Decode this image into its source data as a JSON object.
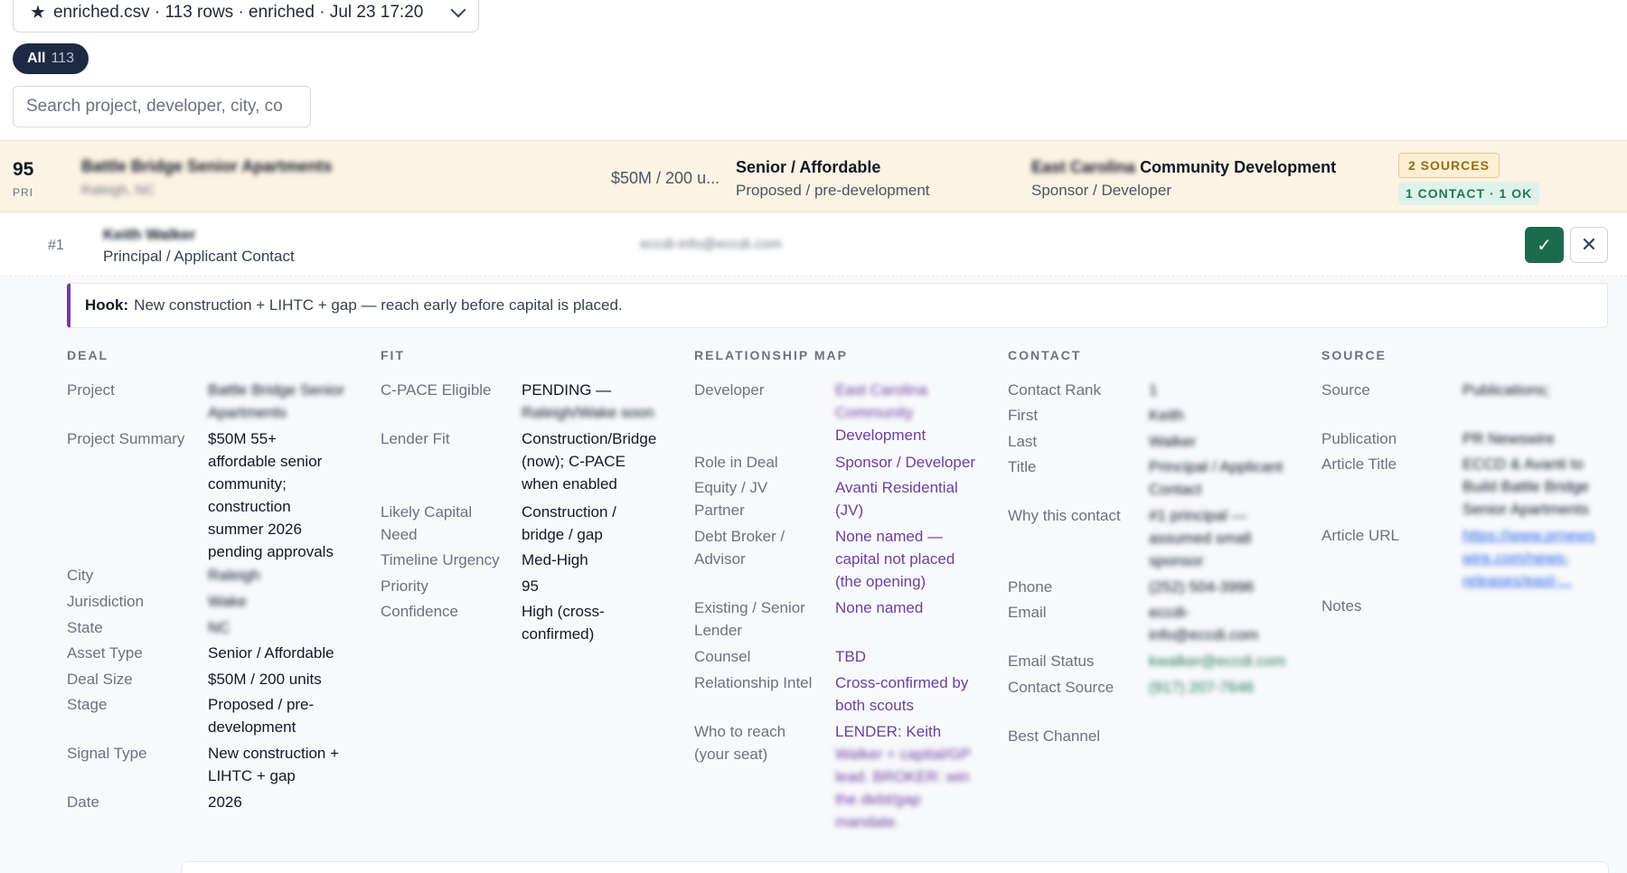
{
  "file": {
    "star": "★",
    "label": "enriched.csv · 113 rows · enriched · Jul 23 17:20"
  },
  "filter": {
    "label": "All",
    "count": "113"
  },
  "search": {
    "placeholder": "Search project, developer, city, co"
  },
  "deal": {
    "priority": "95",
    "priority_label": "PRI",
    "project": "Battle Bridge Senior Apartments",
    "location": "Raleigh, NC",
    "size": "$50M / 200 u...",
    "asset_type": "Senior / Affordable",
    "stage": "Proposed / pre-development",
    "sponsor_blurred": "East Carolina",
    "sponsor": "Community Development",
    "role": "Sponsor / Developer",
    "sources_badge": "2 SOURCES",
    "contacts_badge": "1 CONTACT · 1 OK"
  },
  "contact": {
    "rank": "#1",
    "name": "Keith Walker",
    "title": "Principal / Applicant Contact",
    "email": "eccdi-info@eccdi.com",
    "approve_icon": "✓",
    "reject_icon": "✕"
  },
  "hook": {
    "label": "Hook:",
    "text": "New construction + LIHTC + gap — reach early before capital is placed."
  },
  "headers": {
    "deal": "DEAL",
    "fit": "FIT",
    "relationship": "RELATIONSHIP MAP",
    "contact": "CONTACT",
    "source": "SOURCE"
  },
  "deal_fields": [
    {
      "label": "Project",
      "lines": [
        "Battle Bridge Senior",
        "Apartments"
      ],
      "blur": true
    },
    {
      "label": "Project Summary",
      "lines": [
        "$50M 55+",
        "affordable senior",
        "community;",
        "construction",
        "summer 2026",
        "pending approvals"
      ]
    },
    {
      "label": "City",
      "lines": [
        "Raleigh"
      ],
      "blur": true
    },
    {
      "label": "Jurisdiction",
      "lines": [
        "Wake"
      ],
      "blur": true
    },
    {
      "label": "State",
      "lines": [
        "NC"
      ],
      "blur": true
    },
    {
      "label": "Asset Type",
      "lines": [
        "Senior / Affordable"
      ]
    },
    {
      "label": "Deal Size",
      "lines": [
        "$50M / 200 units"
      ]
    },
    {
      "label": "Stage",
      "lines": [
        "Proposed / pre-",
        "development"
      ]
    },
    {
      "label": "Signal Type",
      "lines": [
        "New construction +",
        "LIHTC + gap"
      ]
    },
    {
      "label": "Date",
      "lines": [
        "2026"
      ]
    }
  ],
  "fit_fields": [
    {
      "label": [
        "C-PACE Eligible"
      ],
      "lines": [
        "PENDING —",
        "Raleigh/Wake soon"
      ]
    },
    {
      "label": [
        "Lender Fit"
      ],
      "lines": [
        "Construction/Bridge",
        "(now); C-PACE",
        "when enabled"
      ]
    },
    {
      "label": [
        "Likely Capital",
        "Need"
      ],
      "lines": [
        "Construction /",
        "bridge / gap"
      ]
    },
    {
      "label": [
        "Timeline Urgency"
      ],
      "lines": [
        "Med-High"
      ]
    },
    {
      "label": [
        "Priority"
      ],
      "lines": [
        "95"
      ]
    },
    {
      "label": [
        "Confidence"
      ],
      "lines": [
        "High (cross-",
        "confirmed)"
      ]
    }
  ],
  "rel_fields": [
    {
      "label": [
        "Developer"
      ],
      "lines": [
        "East Carolina",
        "Community",
        "Development"
      ]
    },
    {
      "label": [
        "Role in Deal"
      ],
      "lines": [
        "Sponsor / Developer"
      ]
    },
    {
      "label": [
        "Equity / JV",
        "Partner"
      ],
      "lines": [
        "Avanti Residential",
        "(JV)"
      ]
    },
    {
      "label": [
        "Debt Broker /",
        "Advisor"
      ],
      "lines": [
        "None named —",
        "capital not placed",
        "(the opening)"
      ]
    },
    {
      "label": [
        "Existing / Senior",
        "Lender"
      ],
      "lines": [
        "None named"
      ]
    },
    {
      "label": [
        "Counsel"
      ],
      "lines": [
        "TBD"
      ]
    },
    {
      "label": [
        "Relationship Intel"
      ],
      "lines": [
        "Cross-confirmed by",
        "both scouts"
      ]
    },
    {
      "label": [
        "Who to reach",
        "(your seat)"
      ],
      "lines": [
        "LENDER: Keith",
        "Walker + capital/GP",
        "lead. BROKER: win",
        "the debt/gap",
        "mandate."
      ]
    }
  ],
  "contact_fields": [
    {
      "label": "Contact Rank",
      "lines": [
        "1"
      ]
    },
    {
      "label": "First",
      "lines": [
        "Keith"
      ]
    },
    {
      "label": "Last",
      "lines": [
        "Walker"
      ]
    },
    {
      "label": "Title",
      "lines": [
        "Principal / Applicant",
        "Contact"
      ]
    },
    {
      "label": "Why this contact",
      "lines": [
        "#1 principal —",
        "assumed small",
        "sponsor"
      ]
    },
    {
      "label": "Phone",
      "lines": [
        "(252) 504-3996"
      ]
    },
    {
      "label": "Email",
      "lines": [
        "eccdi-",
        "info@eccdi.com"
      ]
    },
    {
      "label": "Email Status",
      "lines": [
        "kwalker@eccdi.com"
      ]
    },
    {
      "label": "Contact Source",
      "lines": [
        "(917) 207-7646"
      ]
    },
    {
      "label": "Best Channel",
      "lines": [
        ""
      ]
    }
  ],
  "source_fields": [
    {
      "label": "Source",
      "lines": [
        "Publications;"
      ]
    },
    {
      "label": "Publication",
      "lines": [
        "PR Newswire"
      ]
    },
    {
      "label": "Article Title",
      "lines": [
        "ECCD & Avanti to",
        "Build Battle Bridge",
        "Senior Apartments"
      ]
    },
    {
      "label": "Article URL",
      "lines": [
        "https://www.prnews",
        "wire.com/news-",
        "releases/east-..."
      ]
    },
    {
      "label": "Notes",
      "lines": [
        ""
      ]
    }
  ]
}
